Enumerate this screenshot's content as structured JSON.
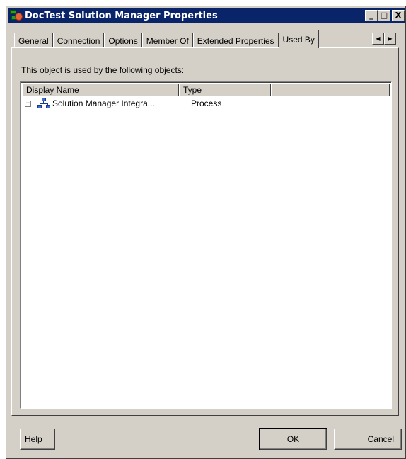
{
  "window": {
    "title": "DocTest Solution Manager Properties",
    "title_buttons": [
      "_",
      "□",
      "X"
    ]
  },
  "tabs": [
    {
      "label": "General",
      "active": false
    },
    {
      "label": "Connection",
      "active": false
    },
    {
      "label": "Options",
      "active": false
    },
    {
      "label": "Member Of",
      "active": false
    },
    {
      "label": "Extended Properties",
      "active": false
    },
    {
      "label": "Used By",
      "active": true
    }
  ],
  "tab_scroll": {
    "left": "◀",
    "right": "▶"
  },
  "panel": {
    "intro": "This object is used by the following objects:",
    "columns": [
      "Display Name",
      "Type"
    ],
    "rows": [
      {
        "expander": "+",
        "icon": "process-icon",
        "name": "Solution Manager Integra...",
        "type": "Process"
      }
    ]
  },
  "buttons": {
    "help": "Help",
    "ok": "OK",
    "cancel": "Cancel"
  },
  "colors": {
    "titlebar": "#0a246a",
    "face": "#d4d0c8"
  }
}
